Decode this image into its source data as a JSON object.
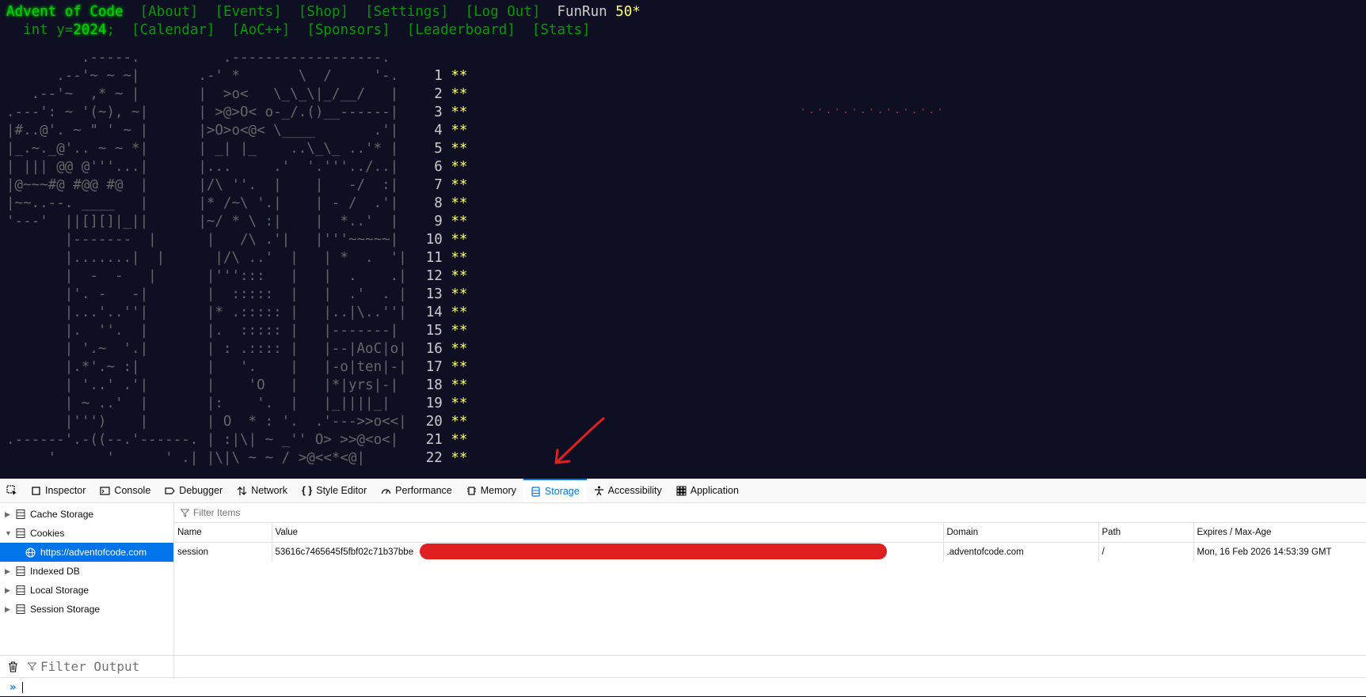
{
  "aoc": {
    "site_title": "Advent of Code",
    "nav1": [
      "[About]",
      "[Events]",
      "[Shop]",
      "[Settings]",
      "[Log Out]"
    ],
    "user": "FunRun",
    "star_count": "50*",
    "year_prefix": "  int y=",
    "year_value": "2024",
    "year_suffix": ";",
    "nav2": [
      "[Calendar]",
      "[AoC++]",
      "[Sponsors]",
      "[Leaderboard]",
      "[Stats]"
    ],
    "calendar_days": [
      {
        "day": "1",
        "stars": "**"
      },
      {
        "day": "2",
        "stars": "**"
      },
      {
        "day": "3",
        "stars": "**"
      },
      {
        "day": "4",
        "stars": "**"
      },
      {
        "day": "5",
        "stars": "**"
      },
      {
        "day": "6",
        "stars": "**"
      },
      {
        "day": "7",
        "stars": "**"
      },
      {
        "day": "8",
        "stars": "**"
      },
      {
        "day": "9",
        "stars": "**"
      },
      {
        "day": "10",
        "stars": "**"
      },
      {
        "day": "11",
        "stars": "**"
      },
      {
        "day": "12",
        "stars": "**"
      },
      {
        "day": "13",
        "stars": "**"
      },
      {
        "day": "14",
        "stars": "**"
      },
      {
        "day": "15",
        "stars": "**"
      },
      {
        "day": "16",
        "stars": "**"
      },
      {
        "day": "17",
        "stars": "**"
      },
      {
        "day": "18",
        "stars": "**"
      },
      {
        "day": "19",
        "stars": "**"
      },
      {
        "day": "20",
        "stars": "**"
      },
      {
        "day": "21",
        "stars": "**"
      },
      {
        "day": "22",
        "stars": "**"
      }
    ],
    "poster_lines": [
      "         .-----.          .------------------.",
      "      .--'~ ~ ~|       .-' *       \\  /     '-.",
      "   .--'~  ,* ~ |       |  >o<   \\_\\_\\|_/__/   |",
      ".---': ~ '(~), ~|      | >@>O< o-_/.()__------|",
      "|#..@'. ~ \" ' ~ |      |>O>o<@< \\____       .'|",
      "|_.~._@'.. ~ ~ *|      | _| |_    ..\\_\\_ ..'* |",
      "| ||| @@ @'''...|      |...     .'  '.'''../..|",
      "|@~~~#@ #@@ #@  |      |/\\ ''.  |    |   -/  :|",
      "|~~..--. ____   |      |* /~\\ '.|    | - /  .'|",
      "'---'  ||[][]|_||      |~/ * \\ :|    |  *..'  |",
      "       |-------  |      |   /\\ .'|   |'''~~~~~|",
      "       |.......|  |      |/\\ ..'  |   | *  .  '|",
      "       |  -  -   |      |''':::   |   |  .    .|",
      "       |'. -   -|       |  :::::  |   |  .'  . |",
      "       |...'..''|       |* .::::: |   |..|\\..''|",
      "       |.  ''.  |       |.  ::::: |   |-------|",
      "       | '.~  '.|       | : .:::: |   |--|AoC|o|",
      "       |.*'.~ :|        |   '.    |   |-o|ten|-|",
      "       | '..' .'|       |    'O   |   |*|yrs|-|",
      "       | ~ ..'  |       |:    '.  |   |_||||_|",
      "       |''')    |       | O  * : '.  .'--->>o<<|",
      ".------'.-((--.'------. | :|\\| ~ _'' O> >>@<o<|",
      "     '      '      ' .| |\\|\\ ~ ~ / >@<<*<@|"
    ]
  },
  "devtools": {
    "tabs": [
      {
        "label": "Inspector",
        "icon": "inspector-icon"
      },
      {
        "label": "Console",
        "icon": "console-icon"
      },
      {
        "label": "Debugger",
        "icon": "debugger-icon"
      },
      {
        "label": "Network",
        "icon": "network-icon"
      },
      {
        "label": "Style Editor",
        "icon": "style-editor-icon"
      },
      {
        "label": "Performance",
        "icon": "performance-icon"
      },
      {
        "label": "Memory",
        "icon": "memory-icon"
      },
      {
        "label": "Storage",
        "icon": "storage-icon"
      },
      {
        "label": "Accessibility",
        "icon": "accessibility-icon"
      },
      {
        "label": "Application",
        "icon": "application-icon"
      }
    ],
    "active_tab": "Storage",
    "tree": {
      "cache_storage": "Cache Storage",
      "cookies": "Cookies",
      "cookie_origin": "https://adventofcode.com",
      "indexed_db": "Indexed DB",
      "local_storage": "Local Storage",
      "session_storage": "Session Storage"
    },
    "filter_placeholder": "Filter Items",
    "columns": [
      "Name",
      "Value",
      "Domain",
      "Path",
      "Expires / Max-Age"
    ],
    "rows": [
      {
        "name": "session",
        "value": "53616c7465645f5fbf02c71b37bbe",
        "domain": ".adventofcode.com",
        "path": "/",
        "expires": "Mon, 16 Feb 2026 14:53:39 GMT"
      }
    ],
    "console_filter_placeholder": "Filter Output"
  },
  "colors": {
    "aoc_bg": "#0f0f23",
    "aoc_green": "#00cc00",
    "aoc_star": "#ffff66",
    "devtools_accent": "#0074e8",
    "redaction": "#e02020",
    "annotation_arrow": "#e02020"
  }
}
